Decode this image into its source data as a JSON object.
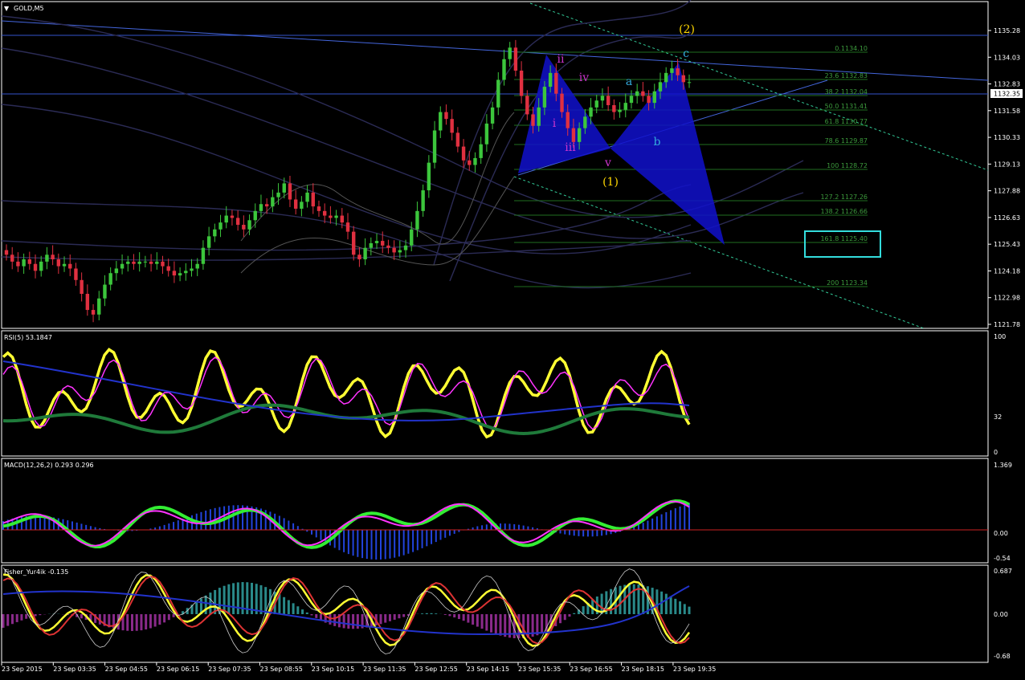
{
  "window": {
    "title": "GOLD,M5"
  },
  "colors": {
    "background": "#000000",
    "bull_candle": "#3cc63c",
    "bear_candle": "#e03040",
    "grid_border": "#ffffff",
    "fib_line": "#1f6e1f",
    "fib_text": "#3c9a3c",
    "wave_primary": "#ffd700",
    "wave_minor": "#cc33cc",
    "wave_abc": "#33aadd",
    "harmonic_fill": "#1111cc",
    "target_box": "#33dddd"
  },
  "price_axis": {
    "ticks": [
      "1135.28",
      "1134.03",
      "1132.83",
      "1131.58",
      "1130.33",
      "1129.13",
      "1127.88",
      "1126.63",
      "1125.43",
      "1124.18",
      "1122.98",
      "1121.78"
    ],
    "current_price": "1132.35"
  },
  "time_axis": {
    "ticks": [
      "23 Sep 2015",
      "23 Sep 03:35",
      "23 Sep 04:55",
      "23 Sep 06:15",
      "23 Sep 07:35",
      "23 Sep 08:55",
      "23 Sep 10:15",
      "23 Sep 11:35",
      "23 Sep 12:55",
      "23 Sep 14:15",
      "23 Sep 15:35",
      "23 Sep 16:55",
      "23 Sep 18:15",
      "23 Sep 19:35"
    ]
  },
  "fibonacci": [
    {
      "label": "0.1134.10"
    },
    {
      "label": "23.6 1132.83"
    },
    {
      "label": "38.2 1132.04"
    },
    {
      "label": "50.0 1131.41"
    },
    {
      "label": "61.8 1130.77"
    },
    {
      "label": "78.6 1129.87"
    },
    {
      "label": "100 1128.72"
    },
    {
      "label": "127.2 1127.26"
    },
    {
      "label": "138.2 1126.66"
    },
    {
      "label": "161.8 1125.40"
    },
    {
      "label": "200 1123.34"
    }
  ],
  "waves": {
    "primary": [
      "(1)",
      "(2)"
    ],
    "minor": [
      "i",
      "ii",
      "iii",
      "iv",
      "v"
    ],
    "abc": [
      "a",
      "b",
      "c"
    ]
  },
  "indicators": {
    "rsi": {
      "label": "RSI(5) 53.1847",
      "ticks": [
        "100",
        "32",
        "0"
      ]
    },
    "macd": {
      "label": "MACD(12,26,2) 0.293 0.296",
      "ticks": [
        "1.369",
        "0.00",
        "-0.54"
      ]
    },
    "fisher": {
      "label": "Fisher_Yur4ik -0.135",
      "ticks": [
        "0.687",
        "0.00",
        "-0.68"
      ]
    }
  },
  "chart_data": {
    "type": "candlestick",
    "title": "GOLD,M5",
    "ylim": [
      1121.7,
      1135.9
    ],
    "series": [
      {
        "name": "GOLD,M5",
        "close": [
          1124.9,
          1124.6,
          1124.4,
          1124.7,
          1124.5,
          1124.2,
          1124.6,
          1124.9,
          1124.7,
          1124.4,
          1124.5,
          1124.3,
          1123.8,
          1123.2,
          1122.5,
          1122.3,
          1123.0,
          1123.6,
          1124.1,
          1124.3,
          1124.5,
          1124.6,
          1124.5,
          1124.6,
          1124.6,
          1124.5,
          1124.6,
          1124.4,
          1124.2,
          1124.0,
          1124.1,
          1124.2,
          1124.3,
          1124.5,
          1125.2,
          1125.7,
          1126.0,
          1126.3,
          1126.6,
          1126.5,
          1126.2,
          1126.0,
          1126.4,
          1126.8,
          1127.1,
          1127.0,
          1127.4,
          1127.6,
          1128.0,
          1127.3,
          1126.9,
          1127.2,
          1127.6,
          1127.0,
          1126.8,
          1126.6,
          1126.5,
          1126.6,
          1126.3,
          1125.9,
          1124.9,
          1124.7,
          1125.2,
          1125.4,
          1125.5,
          1125.3,
          1125.2,
          1125.0,
          1125.1,
          1125.3,
          1126.0,
          1126.8,
          1127.7,
          1128.9,
          1130.3,
          1131.1,
          1130.8,
          1130.2,
          1129.6,
          1129.0,
          1128.8,
          1129.1,
          1129.7,
          1130.6,
          1131.3,
          1132.5,
          1133.4,
          1133.9,
          1132.9,
          1131.8,
          1131.0,
          1130.5,
          1131.3,
          1132.2,
          1132.8,
          1131.9,
          1131.1,
          1130.4,
          1129.8,
          1130.4,
          1130.9,
          1131.3,
          1131.6,
          1131.8,
          1131.4,
          1131.1,
          1131.2,
          1131.5,
          1131.8,
          1132.0,
          1131.8,
          1131.5,
          1132.0,
          1132.4,
          1132.8,
          1133.0,
          1132.7,
          1132.4,
          1132.4
        ]
      }
    ]
  }
}
